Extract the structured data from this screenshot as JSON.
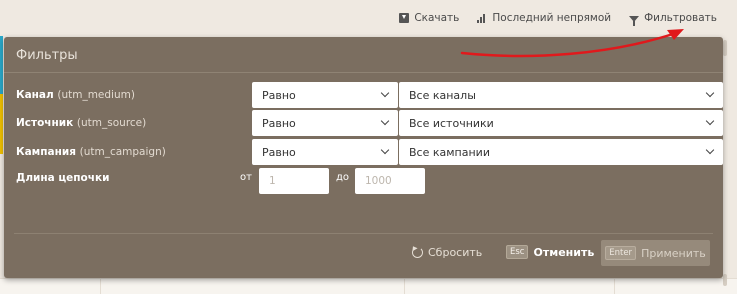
{
  "toolbar": {
    "download_label": "Скачать",
    "last_indirect_label": "Последний непрямой",
    "filter_label": "Фильтровать"
  },
  "panel": {
    "title": "Фильтры",
    "rows": [
      {
        "label": "Канал",
        "param": "(utm_medium)",
        "operator": "Равно",
        "value": "Все каналы"
      },
      {
        "label": "Источник",
        "param": "(utm_source)",
        "operator": "Равно",
        "value": "Все источники"
      },
      {
        "label": "Кампания",
        "param": "(utm_campaign)",
        "operator": "Равно",
        "value": "Все кампании"
      }
    ],
    "chain_length": {
      "label": "Длина цепочки",
      "from_label": "от",
      "from_placeholder": "1",
      "to_label": "до",
      "to_placeholder": "1000"
    },
    "buttons": {
      "reset_label": "Сбросить",
      "cancel_key": "Esc",
      "cancel_label": "Отменить",
      "apply_key": "Enter",
      "apply_label": "Применить"
    }
  },
  "colors": {
    "panel_bg": "#7b6e60",
    "page_bg": "#efe9e1",
    "arrow": "#e0191c",
    "accent_cyan": "#2aa7c7",
    "accent_yellow": "#f0c000"
  }
}
